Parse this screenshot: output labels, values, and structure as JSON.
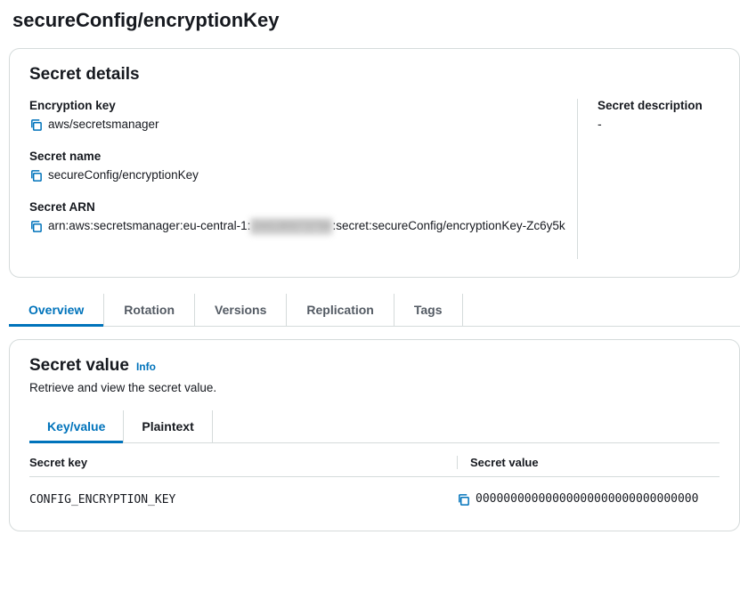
{
  "page": {
    "title": "secureConfig/encryptionKey"
  },
  "details": {
    "panel_title": "Secret details",
    "encryption_key": {
      "label": "Encryption key",
      "value": "aws/secretsmanager"
    },
    "secret_name": {
      "label": "Secret name",
      "value": "secureConfig/encryptionKey"
    },
    "secret_arn": {
      "label": "Secret ARN",
      "prefix": "arn:aws:secretsmanager:eu-central-1:",
      "redacted": "244190073794",
      "suffix": ":secret:secureConfig/encryptionKey-Zc6y5k"
    },
    "description": {
      "label": "Secret description",
      "value": "-"
    }
  },
  "tabs": {
    "overview": "Overview",
    "rotation": "Rotation",
    "versions": "Versions",
    "replication": "Replication",
    "tags": "Tags"
  },
  "secret_value": {
    "title": "Secret value",
    "info": "Info",
    "subtext": "Retrieve and view the secret value.",
    "subtabs": {
      "keyvalue": "Key/value",
      "plaintext": "Plaintext"
    },
    "columns": {
      "key": "Secret key",
      "value": "Secret value"
    },
    "rows": [
      {
        "key": "CONFIG_ENCRYPTION_KEY",
        "value": "00000000000000000000000000000000"
      }
    ]
  }
}
